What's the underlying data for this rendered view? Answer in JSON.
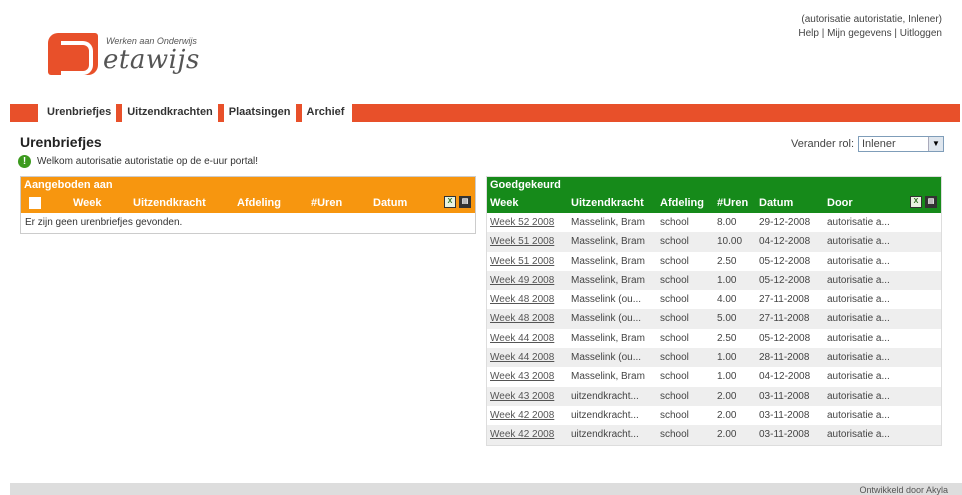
{
  "header": {
    "logo_tag": "Werken aan Onderwijs",
    "logo_word": "etawijs",
    "user_line": "(autorisatie autoristatie, Inlener)",
    "links": [
      "Help",
      "Mijn gegevens",
      "Uitloggen"
    ]
  },
  "nav": {
    "tabs": [
      "Urenbriefjes",
      "Uitzendkrachten",
      "Plaatsingen",
      "Archief"
    ],
    "active": "Urenbriefjes"
  },
  "page": {
    "title": "Urenbriefjes",
    "welcome": "Welkom autorisatie autoristatie op de e-uur portal!",
    "role_label": "Verander rol:",
    "role_value": "Inlener"
  },
  "offered": {
    "title": "Aangeboden aan",
    "columns": [
      "Week",
      "Uitzendkracht",
      "Afdeling",
      "#Uren",
      "Datum"
    ],
    "empty_message": "Er zijn geen urenbriefjes gevonden."
  },
  "approved": {
    "title": "Goedgekeurd",
    "columns": [
      "Week",
      "Uitzendkracht",
      "Afdeling",
      "#Uren",
      "Datum",
      "Door"
    ],
    "rows": [
      {
        "week": "Week 52 2008",
        "uitzendkracht": "Masselink, Bram",
        "afdeling": "school",
        "uren": "8.00",
        "datum": "29-12-2008",
        "door": "autorisatie a..."
      },
      {
        "week": "Week 51 2008",
        "uitzendkracht": "Masselink, Bram",
        "afdeling": "school",
        "uren": "10.00",
        "datum": "04-12-2008",
        "door": "autorisatie a..."
      },
      {
        "week": "Week 51 2008",
        "uitzendkracht": "Masselink, Bram",
        "afdeling": "school",
        "uren": "2.50",
        "datum": "05-12-2008",
        "door": "autorisatie a..."
      },
      {
        "week": "Week 49 2008",
        "uitzendkracht": "Masselink, Bram",
        "afdeling": "school",
        "uren": "1.00",
        "datum": "05-12-2008",
        "door": "autorisatie a..."
      },
      {
        "week": "Week 48 2008",
        "uitzendkracht": "Masselink (ou...",
        "afdeling": "school",
        "uren": "4.00",
        "datum": "27-11-2008",
        "door": "autorisatie a..."
      },
      {
        "week": "Week 48 2008",
        "uitzendkracht": "Masselink (ou...",
        "afdeling": "school",
        "uren": "5.00",
        "datum": "27-11-2008",
        "door": "autorisatie a..."
      },
      {
        "week": "Week 44 2008",
        "uitzendkracht": "Masselink, Bram",
        "afdeling": "school",
        "uren": "2.50",
        "datum": "05-12-2008",
        "door": "autorisatie a..."
      },
      {
        "week": "Week 44 2008",
        "uitzendkracht": "Masselink (ou...",
        "afdeling": "school",
        "uren": "1.00",
        "datum": "28-11-2008",
        "door": "autorisatie a..."
      },
      {
        "week": "Week 43 2008",
        "uitzendkracht": "Masselink, Bram",
        "afdeling": "school",
        "uren": "1.00",
        "datum": "04-12-2008",
        "door": "autorisatie a..."
      },
      {
        "week": "Week 43 2008",
        "uitzendkracht": "uitzendkracht...",
        "afdeling": "school",
        "uren": "2.00",
        "datum": "03-11-2008",
        "door": "autorisatie a..."
      },
      {
        "week": "Week 42 2008",
        "uitzendkracht": "uitzendkracht...",
        "afdeling": "school",
        "uren": "2.00",
        "datum": "03-11-2008",
        "door": "autorisatie a..."
      },
      {
        "week": "Week 42 2008",
        "uitzendkracht": "uitzendkracht...",
        "afdeling": "school",
        "uren": "2.00",
        "datum": "03-11-2008",
        "door": "autorisatie a..."
      }
    ]
  },
  "footer": {
    "text": "Ontwikkeld door Akyla"
  },
  "colors": {
    "brand": "#e8502a",
    "offered_header": "#f7960f",
    "approved_header": "#168a1a"
  },
  "icons": [
    "logo-icon",
    "info-icon",
    "excel-export-icon",
    "print-icon",
    "dropdown-arrow-icon"
  ]
}
